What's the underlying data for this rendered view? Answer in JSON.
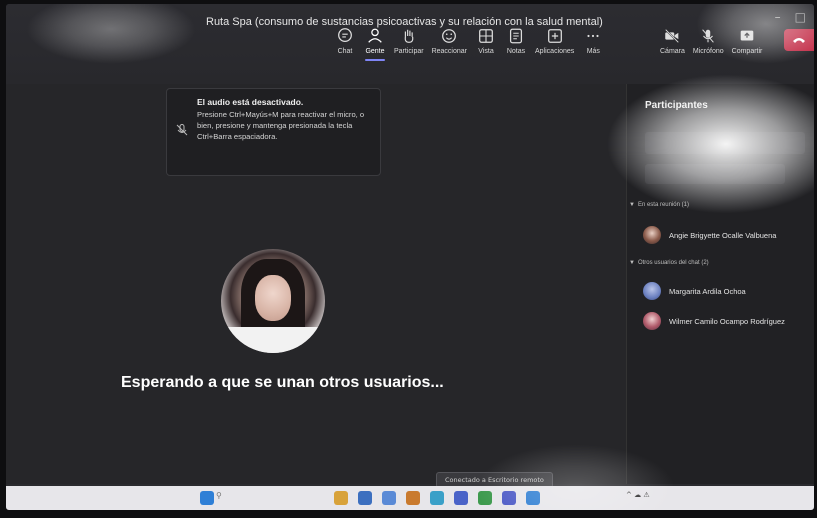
{
  "window": {
    "title": "Ruta Spa (consumo de sustancias psicoactivas y su relación con la salud mental)"
  },
  "toolbar": {
    "items": [
      {
        "label": "Chat",
        "icon": "chat-icon"
      },
      {
        "label": "Gente",
        "icon": "people-icon",
        "active": true
      },
      {
        "label": "Participar",
        "icon": "raise-hand-icon"
      },
      {
        "label": "Reaccionar",
        "icon": "smiley-icon"
      },
      {
        "label": "Vista",
        "icon": "grid-view-icon"
      },
      {
        "label": "Notas",
        "icon": "notes-icon"
      },
      {
        "label": "Aplicaciones",
        "icon": "apps-icon"
      },
      {
        "label": "Más",
        "icon": "more-icon"
      }
    ],
    "media": [
      {
        "label": "Cámara",
        "icon": "camera-off-icon"
      },
      {
        "label": "Micrófono",
        "icon": "mic-off-icon"
      },
      {
        "label": "Compartir",
        "icon": "share-icon"
      }
    ],
    "accent": "#7f85f5",
    "leave_color": "#c4314b"
  },
  "toast": {
    "title": "El audio está desactivado.",
    "body": "Presione Ctrl+Mayús+M para reactivar el micro, o bien, presione y mantenga presionada la tecla Ctrl+Barra espaciadora."
  },
  "stage": {
    "waiting_text": "Esperando a que se unan otros usuarios...",
    "remote_chip": "Conectado a Escritorio remoto"
  },
  "participants": {
    "title": "Participantes",
    "sections": [
      {
        "label": "En esta reunión (1)",
        "people": [
          {
            "name": "Angie Brigyette Ocalle Valbuena"
          }
        ]
      },
      {
        "label": "Otros usuarios del chat (2)",
        "people": [
          {
            "name": "Margarita Ardila Ochoa"
          },
          {
            "name": "Wilmer Camilo Ocampo Rodríguez"
          }
        ]
      }
    ]
  }
}
